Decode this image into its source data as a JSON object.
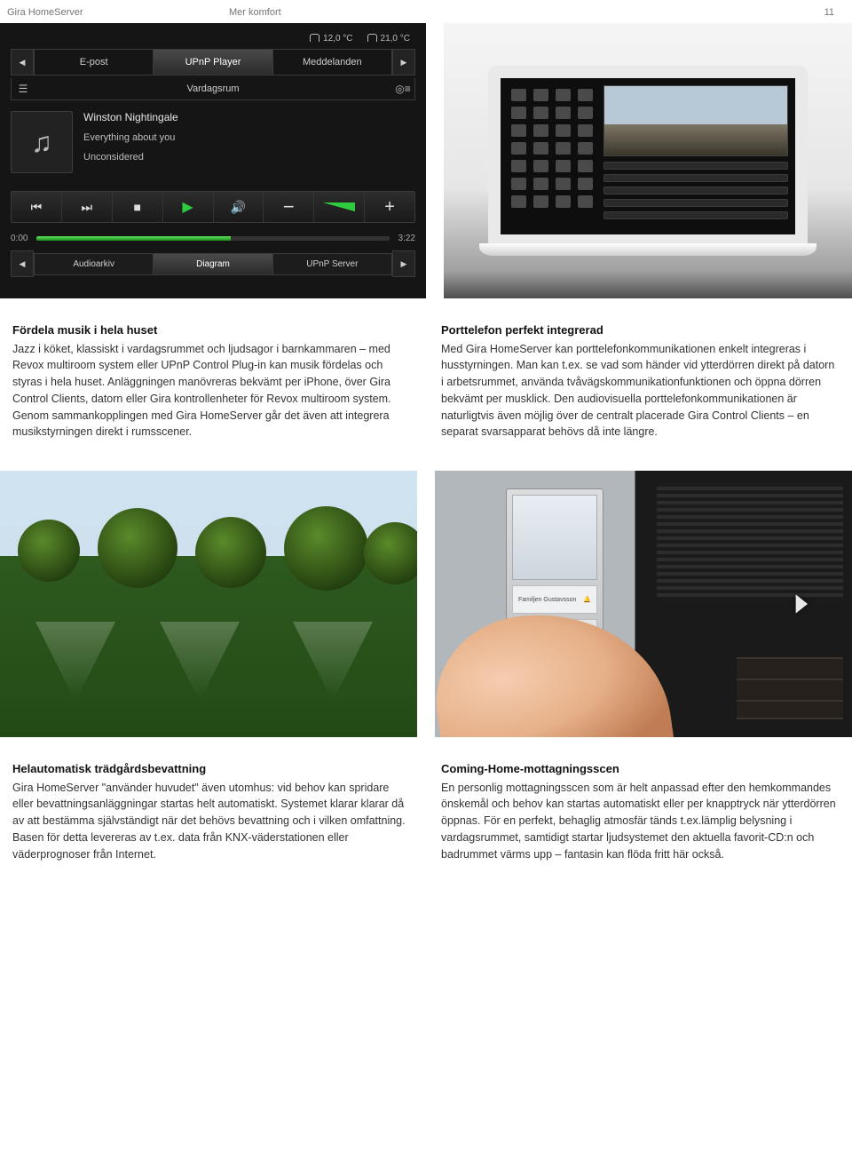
{
  "header": {
    "title": "Gira HomeServer",
    "subtitle": "Mer komfort",
    "page": "11"
  },
  "player": {
    "weather": {
      "temp1": "12,0 °C",
      "temp2": "21,0 °C"
    },
    "tabs": {
      "left": "E-post",
      "mid": "UPnP Player",
      "right": "Meddelanden"
    },
    "room": "Vardagsrum",
    "track": {
      "artist": "Winston Nightingale",
      "album": "Everything about you",
      "title": "Unconsidered"
    },
    "time": {
      "elapsed": "0:00",
      "total": "3:22"
    },
    "sources": {
      "a": "Audioarkiv",
      "b": "Diagram",
      "c": "UPnP Server"
    }
  },
  "block1": {
    "left": {
      "h": "Fördela musik i hela huset",
      "p": "Jazz i köket, klassiskt i vardagsrummet och ljudsagor i barnkammaren – med Revox multiroom system eller UPnP Control Plug-in kan musik fördelas och styras i hela huset. Anläggningen manövreras bekvämt per iPhone, över Gira Control Clients, datorn eller Gira kontrollenheter för Revox multiroom system. Genom sammankopplingen med Gira HomeServer går det även att integrera musikstyrningen direkt i rumsscener."
    },
    "right": {
      "h": "Porttelefon perfekt integrerad",
      "p": "Med Gira HomeServer kan porttelefonkommunikationen enkelt integreras i husstyrningen. Man kan t.ex. se vad som händer vid ytterdörren direkt på datorn i arbetsrummet, använda tvåvägskommunikationfunktionen och öppna dörren bekvämt per musklick. Den audiovisuella porttelefonkommunikationen är naturligtvis även möjlig över de centralt placerade Gira Control Clients – en separat svarsapparat behövs då inte längre."
    }
  },
  "doorstation": {
    "nameplate": "Familjen Gustavsson"
  },
  "block2": {
    "left": {
      "h": "Helautomatisk trädgårdsbevattning",
      "p": "Gira HomeServer \"använder huvudet\" även utomhus: vid behov kan spridare eller bevattningsanläggningar startas helt automatiskt. Systemet klarar klarar då av att bestämma självständigt när det behövs bevattning och i vilken omfattning. Basen för detta levereras av t.ex. data från KNX-väderstationen eller väderprognoser från Internet."
    },
    "right": {
      "h": "Coming-Home-mottagningsscen",
      "p": "En personlig mottagningsscen som är helt anpassad efter den hemkommandes önskemål och behov kan startas automatiskt eller per knapptryck när ytterdörren öppnas. För en perfekt, behaglig atmosfär tänds t.ex.lämplig belysning i vardagsrummet, samtidigt startar ljudsystemet den aktuella favorit-CD:n och badrummet värms upp – fantasin kan flöda fritt här också."
    }
  }
}
